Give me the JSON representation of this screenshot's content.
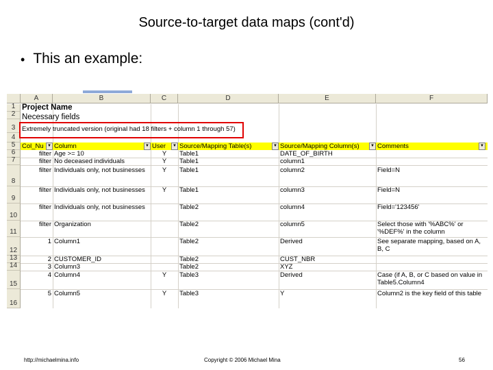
{
  "slide": {
    "title": "Source-to-target data maps (cont'd)",
    "bullet": "This an example:",
    "footer_left": "http://michaelmina.info",
    "footer_center": "Copyright © 2006 Michael Mina",
    "footer_right": "56"
  },
  "sheet": {
    "columns": [
      "A",
      "B",
      "C",
      "D",
      "E",
      "F"
    ],
    "rows": [
      "1",
      "2",
      "3",
      "4",
      "5",
      "6",
      "7",
      "8",
      "9",
      "10",
      "11",
      "12",
      "13",
      "14",
      "15",
      "16"
    ],
    "project_name": "Project Name",
    "necessary_fields": "Necessary fields",
    "truncated_note": "Extremely truncated version (original had 18 filters + column 1 through 57)",
    "headers": [
      "Col_Nu",
      "Column",
      "User",
      "Source/Mapping Table(s)",
      "Source/Mapping Column(s)",
      "Comments"
    ],
    "data": [
      {
        "a": "filter",
        "b": "Age >= 10",
        "c": "Y",
        "d": "Table1",
        "e": "DATE_OF_BIRTH",
        "f": ""
      },
      {
        "a": "filter",
        "b": "No deceased individuals",
        "c": "Y",
        "d": "Table1",
        "e": "column1",
        "f": ""
      },
      {
        "a": "filter",
        "b": "Individuals only, not businesses",
        "c": "Y",
        "d": "Table1",
        "e": "column2",
        "f": "Field=N"
      },
      {
        "a": "filter",
        "b": "Individuals only, not businesses",
        "c": "Y",
        "d": "Table1",
        "e": "column3",
        "f": "Field=N"
      },
      {
        "a": "filter",
        "b": "Individuals only, not businesses",
        "c": "",
        "d": "Table2",
        "e": "column4",
        "f": "Field='123456'"
      },
      {
        "a": "filter",
        "b": "Organization",
        "c": "",
        "d": "Table2",
        "e": "column5",
        "f": "Select those with '%ABC%' or '%DEF%' in the column"
      },
      {
        "a": "1",
        "b": "Column1",
        "c": "",
        "d": "Table2",
        "e": "Derived",
        "f": "See separate mapping, based on A, B, C"
      },
      {
        "a": "2",
        "b": "CUSTOMER_ID",
        "c": "",
        "d": "Table2",
        "e": "CUST_NBR",
        "f": ""
      },
      {
        "a": "3",
        "b": "Column3",
        "c": "",
        "d": "Table2",
        "e": "XYZ",
        "f": ""
      },
      {
        "a": "4",
        "b": "Column4",
        "c": "Y",
        "d": "Table3",
        "e": "Derived",
        "f": "Case (if A, B, or C based on value in Table5.Column4"
      },
      {
        "a": "5",
        "b": "Column5",
        "c": "Y",
        "d": "Table3",
        "e": "Y",
        "f": "Column2 is the key field of this table"
      }
    ]
  }
}
